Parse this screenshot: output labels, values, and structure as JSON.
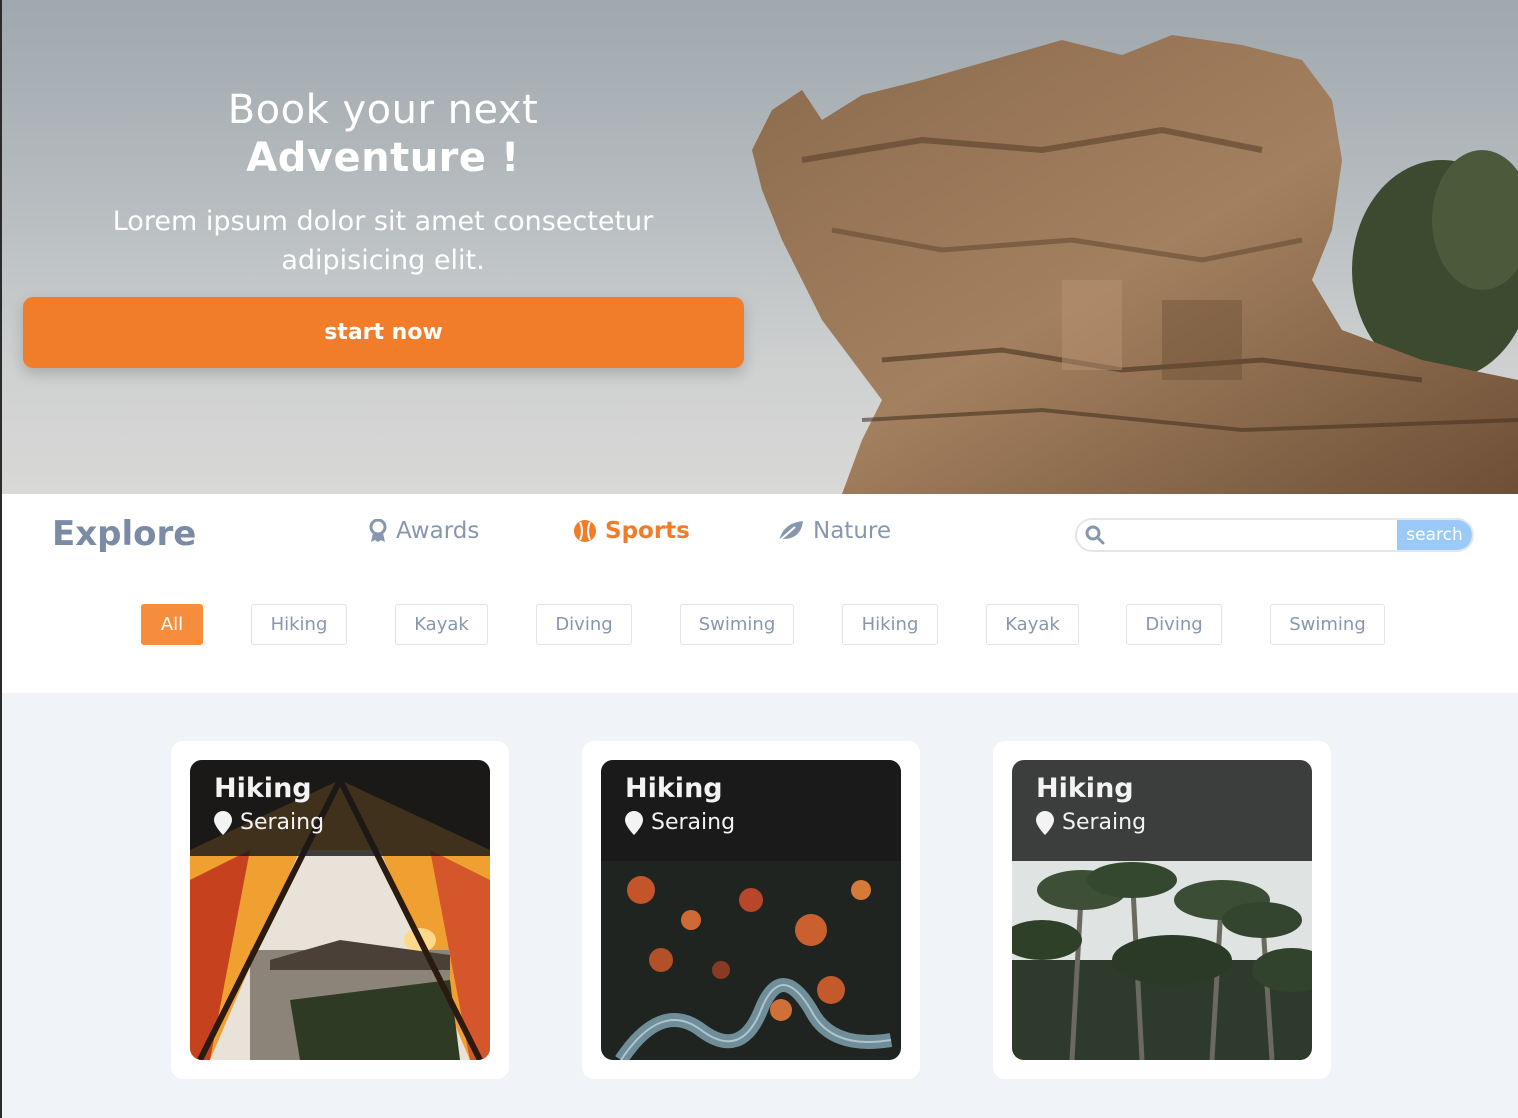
{
  "hero": {
    "title_line1": "Book your next",
    "title_line2": "Adventure !",
    "subtitle": "Lorem ipsum dolor sit amet consectetur adipisicing elit.",
    "cta_label": "start now",
    "cta_color": "#f17c29"
  },
  "explore": {
    "title": "Explore",
    "nav": [
      {
        "label": "Awards",
        "icon": "award-icon",
        "active": false
      },
      {
        "label": "Sports",
        "icon": "baseball-icon",
        "active": true
      },
      {
        "label": "Nature",
        "icon": "leaf-icon",
        "active": false
      }
    ],
    "search": {
      "placeholder": "",
      "button_label": "search"
    }
  },
  "filters": [
    "All",
    "Hiking",
    "Kayak",
    "Diving",
    "Swiming",
    "Hiking",
    "Kayak",
    "Diving",
    "Swiming"
  ],
  "cards": [
    {
      "title": "Hiking",
      "location": "Seraing",
      "image": "tent-lake-photo"
    },
    {
      "title": "Hiking",
      "location": "Seraing",
      "image": "forest-road-photo"
    },
    {
      "title": "Hiking",
      "location": "Seraing",
      "image": "palm-trees-photo"
    }
  ]
}
